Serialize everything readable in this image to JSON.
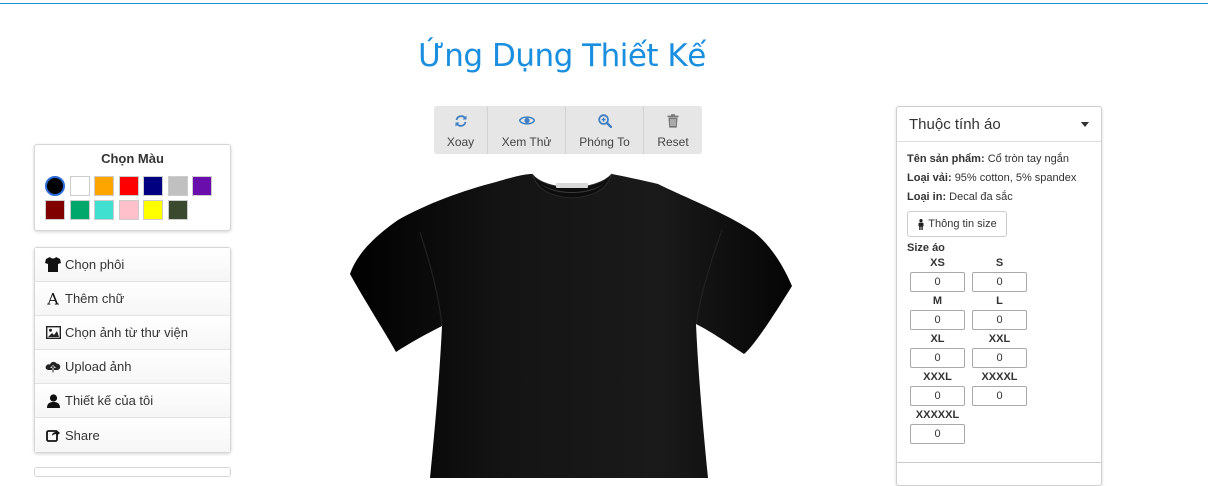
{
  "title": "Ứng Dụng Thiết Kế",
  "colors": {
    "label": "Chọn Màu",
    "swatches": [
      "#000000",
      "#ffffff",
      "#ffa500",
      "#ff0000",
      "#000080",
      "#c0c0c0",
      "#6a0dad",
      "#800000",
      "#00a86b",
      "#40e0d0",
      "#ffc0cb",
      "#ffff00",
      "#3b4a2f"
    ],
    "selected_index": 0
  },
  "menu": [
    {
      "label": "Chọn phôi",
      "icon": "tshirt-icon"
    },
    {
      "label": "Thêm chữ",
      "icon": "text-icon"
    },
    {
      "label": "Chọn ảnh từ thư viện",
      "icon": "image-icon"
    },
    {
      "label": "Upload ảnh",
      "icon": "cloud-upload-icon"
    },
    {
      "label": "Thiết kế của tôi",
      "icon": "user-icon"
    },
    {
      "label": "Share",
      "icon": "share-icon"
    }
  ],
  "toolbar": [
    {
      "label": "Xoay",
      "icon": "rotate-icon"
    },
    {
      "label": "Xem Thử",
      "icon": "eye-icon"
    },
    {
      "label": "Phóng To",
      "icon": "zoom-in-icon"
    },
    {
      "label": "Reset",
      "icon": "trash-icon"
    }
  ],
  "shirt": {
    "color": "#0b0b0b",
    "icon": "tshirt-mockup"
  },
  "props": {
    "header": "Thuộc tính áo",
    "product_label": "Tên sản phẩm:",
    "product_value": "Cổ tròn tay ngắn",
    "fabric_label": "Loại vải:",
    "fabric_value": "95% cotton, 5% spandex",
    "print_label": "Loại in:",
    "print_value": "Decal đa sắc",
    "size_info_button": "Thông tin size",
    "size_title": "Size áo",
    "sizes": [
      {
        "label": "XS",
        "value": "0"
      },
      {
        "label": "S",
        "value": "0"
      },
      {
        "label": "M",
        "value": "0"
      },
      {
        "label": "L",
        "value": "0"
      },
      {
        "label": "XL",
        "value": "0"
      },
      {
        "label": "XXL",
        "value": "0"
      },
      {
        "label": "XXXL",
        "value": "0"
      },
      {
        "label": "XXXXL",
        "value": "0"
      },
      {
        "label": "XXXXXL",
        "value": "0"
      }
    ]
  }
}
